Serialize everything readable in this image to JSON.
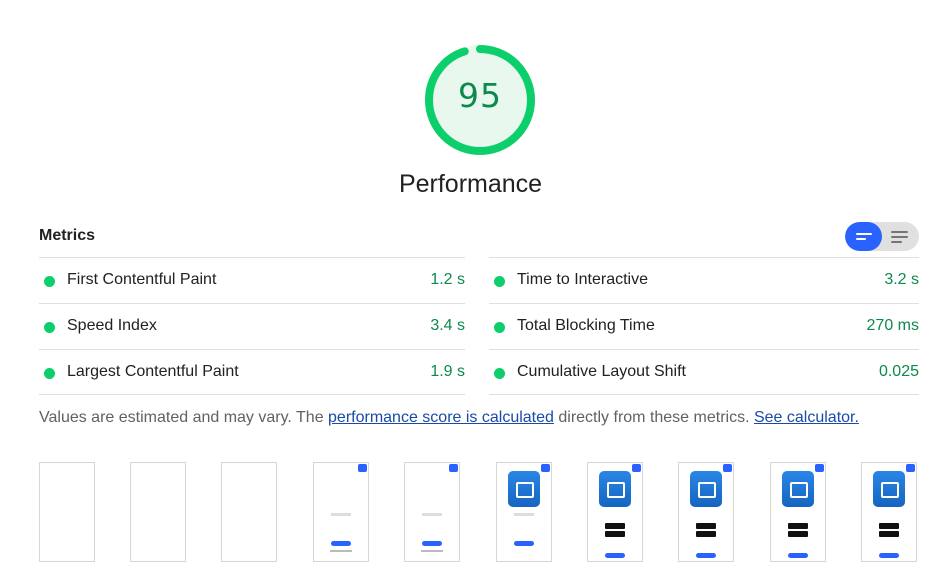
{
  "gauge": {
    "score": "95",
    "score_fraction": 0.95,
    "title": "Performance",
    "ring_color": "#0cce6b",
    "fill_color": "#e8f8ef",
    "text_color": "#0c8a4b"
  },
  "metrics": {
    "title": "Metrics",
    "toggle_icons": [
      "list-view-icon",
      "expanded-view-icon"
    ],
    "left": [
      {
        "name": "First Contentful Paint",
        "value": "1.2 s",
        "status": "pass"
      },
      {
        "name": "Speed Index",
        "value": "3.4 s",
        "status": "pass"
      },
      {
        "name": "Largest Contentful Paint",
        "value": "1.9 s",
        "status": "pass"
      }
    ],
    "right": [
      {
        "name": "Time to Interactive",
        "value": "3.2 s",
        "status": "pass"
      },
      {
        "name": "Total Blocking Time",
        "value": "270 ms",
        "status": "pass"
      },
      {
        "name": "Cumulative Layout Shift",
        "value": "0.025",
        "status": "pass"
      }
    ],
    "pass_color": "#0cce6b"
  },
  "note": {
    "prefix": "Values are estimated and may vary. The ",
    "link1": "performance score is calculated",
    "middle": " directly from these metrics. ",
    "link2": "See calculator."
  },
  "filmstrip": {
    "frames": [
      {
        "state": "blank"
      },
      {
        "state": "blank"
      },
      {
        "state": "blank"
      },
      {
        "state": "text"
      },
      {
        "state": "text"
      },
      {
        "state": "logo"
      },
      {
        "state": "logo-stores"
      },
      {
        "state": "logo-stores"
      },
      {
        "state": "logo-stores"
      },
      {
        "state": "logo-stores"
      }
    ]
  }
}
